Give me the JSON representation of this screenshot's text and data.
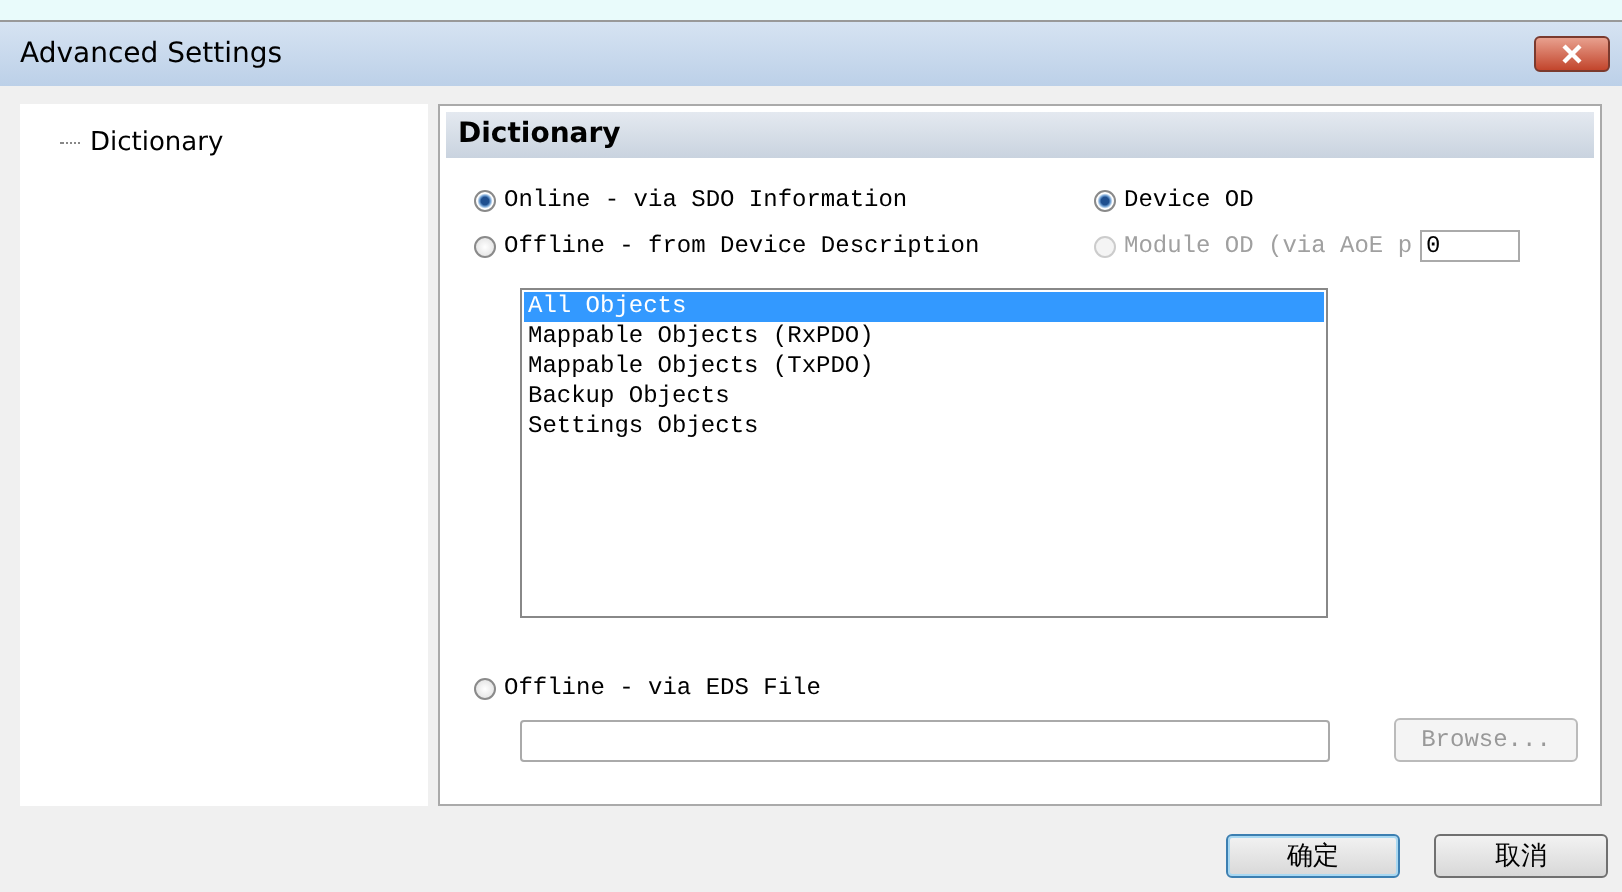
{
  "window": {
    "title": "Advanced Settings"
  },
  "tree": [
    {
      "label": "Dictionary",
      "selected": false
    }
  ],
  "panel": {
    "title": "Dictionary",
    "source_options": [
      {
        "label": "Online - via SDO Information",
        "selected": true,
        "disabled": false
      },
      {
        "label": "Offline - from Device Description",
        "selected": false,
        "disabled": false
      }
    ],
    "od_options": [
      {
        "label": "Device OD",
        "selected": true,
        "disabled": false
      },
      {
        "label": "Module OD (via AoE p",
        "selected": false,
        "disabled": true
      }
    ],
    "module_field": {
      "value": "0"
    },
    "object_list": [
      {
        "label": "All Objects",
        "selected": true
      },
      {
        "label": "Mappable Objects (RxPDO)",
        "selected": false
      },
      {
        "label": "Mappable Objects (TxPDO)",
        "selected": false
      },
      {
        "label": "Backup Objects",
        "selected": false
      },
      {
        "label": "Settings Objects",
        "selected": false
      }
    ],
    "eds_option": {
      "label": "Offline - via EDS File",
      "selected": false,
      "disabled": false
    },
    "browse_button": {
      "label": "Browse...",
      "disabled": true
    }
  },
  "buttons": [
    {
      "label": "确定",
      "kind": "default"
    },
    {
      "label": "取消",
      "kind": "normal"
    }
  ]
}
